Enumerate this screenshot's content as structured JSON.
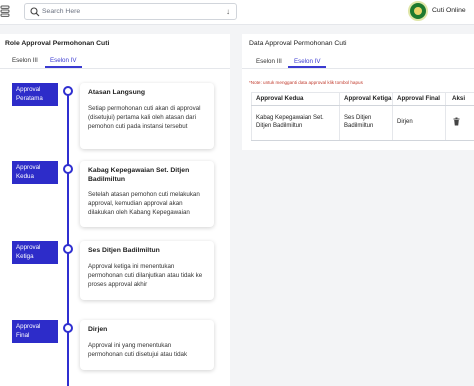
{
  "header": {
    "search_placeholder": "Search Here",
    "user_label": "Cuti Online",
    "icons": {
      "menu": "menu-icon",
      "search": "search-icon",
      "dropdown": "chevron-down-icon"
    }
  },
  "left_panel": {
    "title": "Role Approval Permohonan Cuti",
    "tabs": [
      {
        "label": "Eselon III",
        "active": false
      },
      {
        "label": "Eselon IV",
        "active": true
      }
    ],
    "steps": [
      {
        "label": "Approval Peratama",
        "title": "Atasan Langsung",
        "description": "Setiap permohonan cuti akan di approval (disetujui) pertama kali oleh atasan dari pemohon cuti pada instansi tersebut"
      },
      {
        "label": "Approval Kedua",
        "title": "Kabag Kepegawaian Set. Ditjen Badilmiltun",
        "description": "Setelah atasan pemohon cuti melakukan approval, kemudian approval akan dilakukan oleh Kabang Kepegawaian"
      },
      {
        "label": "Approval Ketiga",
        "title": "Ses Ditjen Badilmiltun",
        "description": "Approval ketiga ini menentukan permohonan cuti dilanjutkan atau tidak ke proses approval akhir"
      },
      {
        "label": "Approval Final",
        "title": "Dirjen",
        "description": "Approval ini yang menentukan permohonan cuti disetujui atau tidak"
      }
    ]
  },
  "right_panel": {
    "title": "Data Approval Permohonan Cuti",
    "tabs": [
      {
        "label": "Eselon III",
        "active": false
      },
      {
        "label": "Eselon IV",
        "active": true
      }
    ],
    "note": "*Note: untuk mengganti data approval klik tombol hapus",
    "columns": [
      "Approval Kedua",
      "Approval Ketiga",
      "Approval Final",
      "Aksi"
    ],
    "rows": [
      {
        "kedua": "Kabag Kepegawaian Set. Ditjen Badilmiltun",
        "ketiga": "Ses Ditjen Badilmiltun",
        "final": "Dirjen",
        "action_icon": "trash-icon"
      }
    ]
  },
  "colors": {
    "accent": "#2f2fd0",
    "label_bg": "#2d2cc9",
    "note": "#c0392b",
    "avatar": "#1d7a2f"
  }
}
